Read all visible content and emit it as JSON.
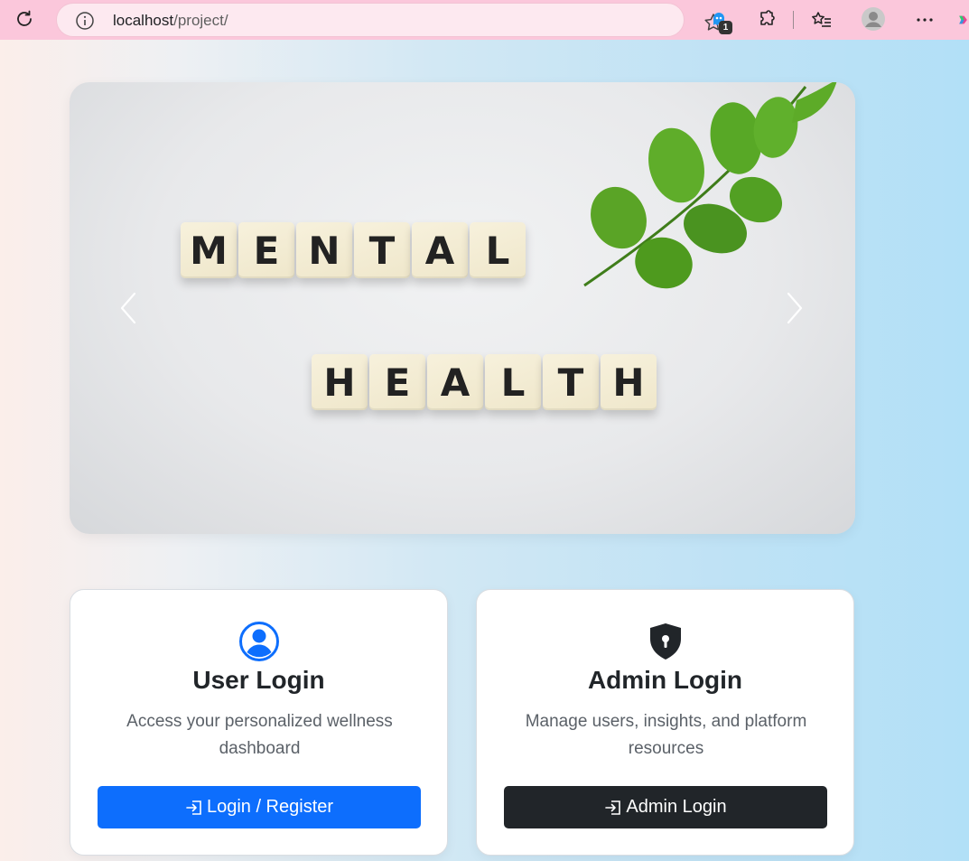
{
  "browser": {
    "url_host": "localhost",
    "url_path": "/project/",
    "extension_badge": "1",
    "icons": [
      "reload-icon",
      "info-icon",
      "star-icon",
      "extension-icon",
      "puzzle-icon",
      "favorites-icon",
      "profile-icon",
      "more-icon",
      "copilot-icon"
    ]
  },
  "carousel": {
    "word1": [
      "M",
      "E",
      "N",
      "T",
      "A",
      "L"
    ],
    "word2": [
      "H",
      "E",
      "A",
      "L",
      "T",
      "H"
    ]
  },
  "cards": {
    "user": {
      "title": "User Login",
      "text": "Access your personalized wellness dashboard",
      "button": "Login / Register",
      "icon": "user-circle-icon"
    },
    "admin": {
      "title": "Admin Login",
      "text": "Manage users, insights, and platform resources",
      "button": "Admin Login",
      "icon": "shield-lock-icon"
    }
  },
  "colors": {
    "toolbar": "#fbc7db",
    "primary": "#0d6efd",
    "dark": "#212529",
    "leaf": "#4f9a1f"
  }
}
